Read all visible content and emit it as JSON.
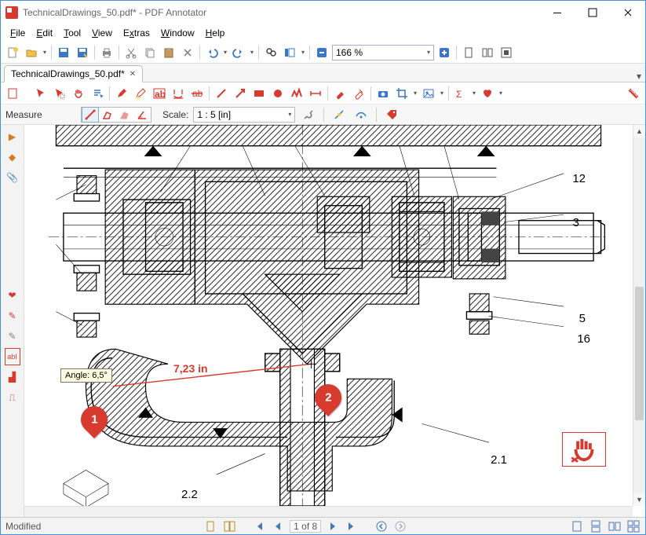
{
  "window": {
    "title": "TechnicalDrawings_50.pdf* - PDF Annotator"
  },
  "menu": {
    "file": "File",
    "edit": "Edit",
    "tool": "Tool",
    "view": "View",
    "extras": "Extras",
    "window": "Window",
    "help": "Help"
  },
  "main_toolbar": {
    "zoom_value": "166 %"
  },
  "tabs": {
    "active": "TechnicalDrawings_50.pdf*"
  },
  "measure_bar": {
    "mode_label": "Measure",
    "scale_label": "Scale:",
    "scale_value": "1 : 5 [in]"
  },
  "canvas": {
    "tooltip": "Angle: 6,5°",
    "measurement": "7,23 in",
    "marker1": "1",
    "marker2": "2",
    "callouts": {
      "c12": "12",
      "c3": "3",
      "c5": "5",
      "c16": "16",
      "c21": "2.1",
      "c22": "2.2"
    }
  },
  "status": {
    "left": "Modified",
    "page": "1 of 8"
  }
}
